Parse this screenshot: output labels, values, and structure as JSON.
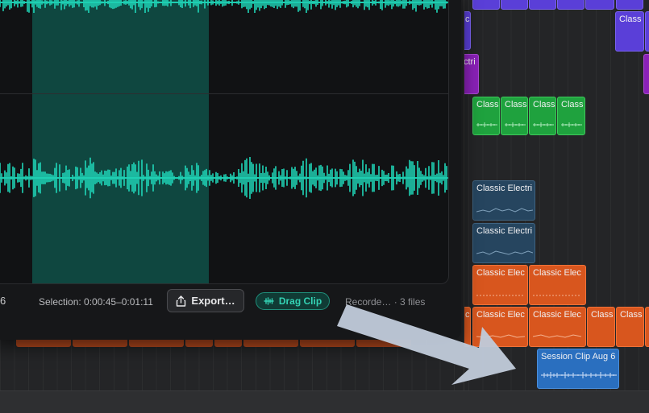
{
  "status": {
    "left_fragment": "6",
    "selection": "Selection: 0:00:45–0:01:11",
    "export_label": "Export…",
    "drag_label": "Drag Clip",
    "recorded": "Recorde… · 3 files"
  },
  "clips": {
    "purple_top_right": "Class",
    "purple_small": "c",
    "magenta_small": "ctri",
    "green": [
      "Class",
      "Class",
      "Class",
      "Class"
    ],
    "navy": [
      "Classic Electri",
      "Classic Electri"
    ],
    "orange_row1": [
      "Classic Elec",
      "Classic Elec"
    ],
    "orange_row2": [
      "c",
      "Classic Elec",
      "Classic Elec",
      "Class",
      "Class"
    ],
    "session": "Session Clip Aug 6"
  },
  "colors": {
    "waveform": "#1fd6b8",
    "selection": "#0f4740",
    "accent": "#34d2b4"
  },
  "icons": {
    "export": "share-icon",
    "drag": "waveform-icon"
  }
}
